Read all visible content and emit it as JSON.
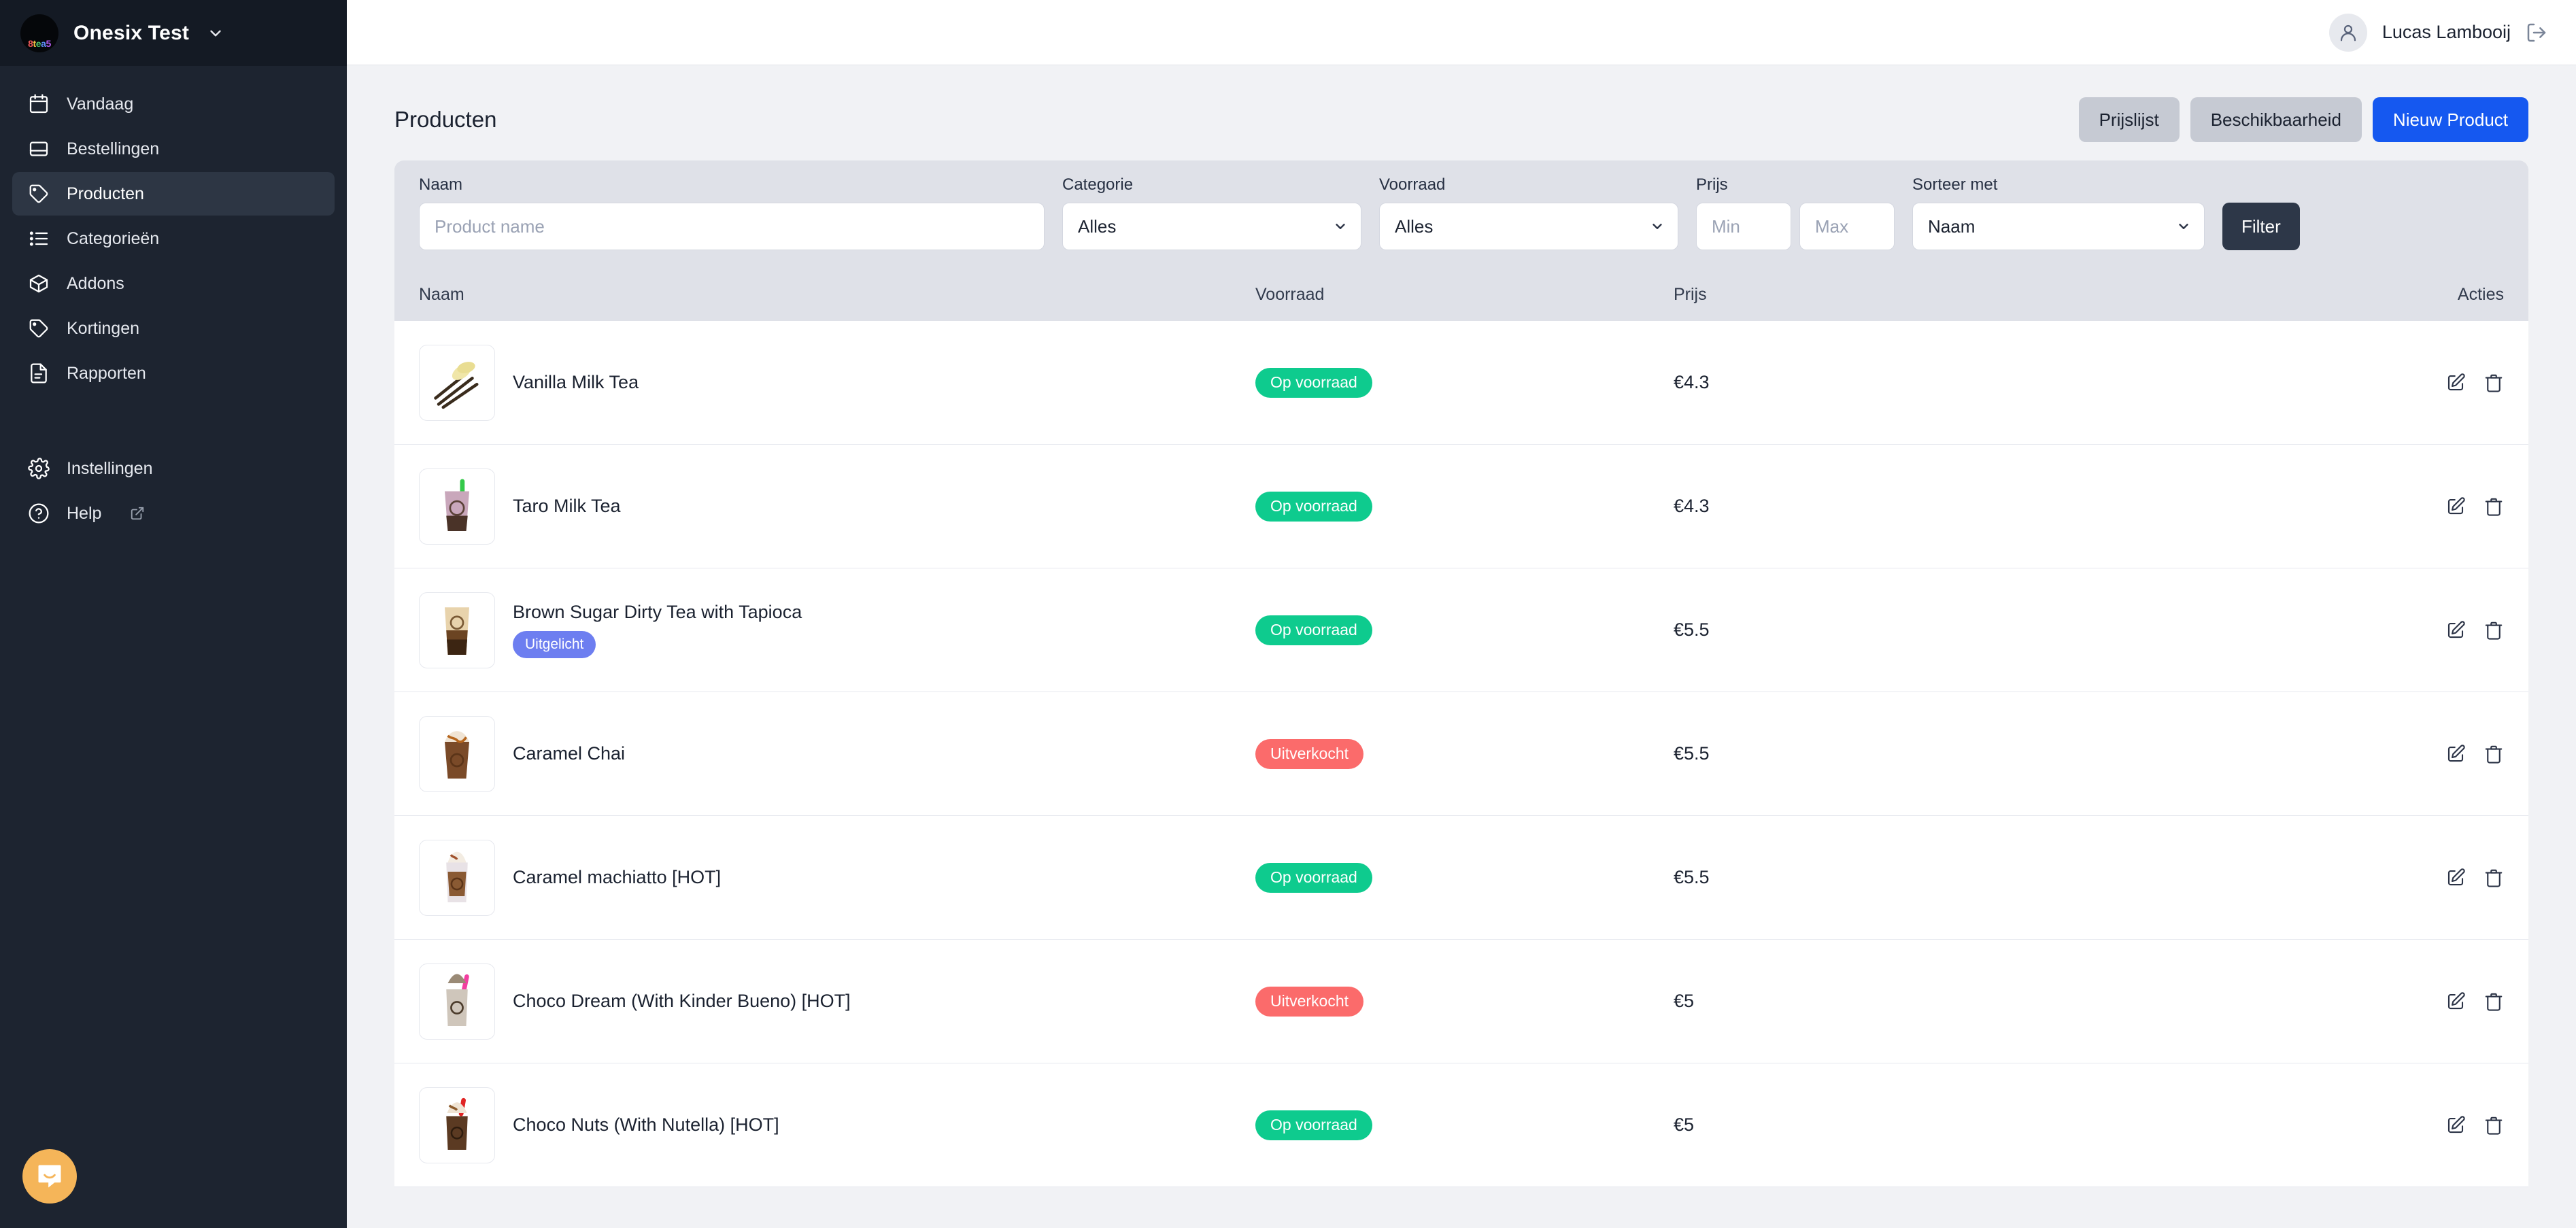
{
  "sidebar": {
    "brand": {
      "name": "Onesix Test",
      "logo_text": "8tea5",
      "caret_icon": "chevron-down-icon"
    },
    "items": [
      {
        "label": "Vandaag",
        "icon": "calendar-icon",
        "active": false
      },
      {
        "label": "Bestellingen",
        "icon": "inbox-icon",
        "active": false
      },
      {
        "label": "Producten",
        "icon": "tag-icon",
        "active": true
      },
      {
        "label": "Categorieën",
        "icon": "list-icon",
        "active": false
      },
      {
        "label": "Addons",
        "icon": "package-icon",
        "active": false
      },
      {
        "label": "Kortingen",
        "icon": "tag-icon",
        "active": false
      },
      {
        "label": "Rapporten",
        "icon": "document-icon",
        "active": false
      }
    ],
    "footer_items": [
      {
        "label": "Instellingen",
        "icon": "gear-icon",
        "external": false
      },
      {
        "label": "Help",
        "icon": "question-mark-icon",
        "external": true
      }
    ],
    "chat_icon": "intercom-chat-icon"
  },
  "topbar": {
    "user_name": "Lucas Lambooij",
    "avatar_icon": "user-avatar-icon",
    "logout_icon": "logout-icon"
  },
  "header": {
    "title": "Producten",
    "buttons": {
      "pricelist": "Prijslijst",
      "availability": "Beschikbaarheid",
      "new_product": "Nieuw Product"
    }
  },
  "filters": {
    "name": {
      "label": "Naam",
      "placeholder": "Product name",
      "value": ""
    },
    "category": {
      "label": "Categorie",
      "value": "Alles",
      "options": [
        "Alles"
      ]
    },
    "stock": {
      "label": "Voorraad",
      "value": "Alles",
      "options": [
        "Alles"
      ]
    },
    "price": {
      "label": "Prijs",
      "min_placeholder": "Min",
      "max_placeholder": "Max",
      "min_value": "",
      "max_value": ""
    },
    "sort": {
      "label": "Sorteer met",
      "value": "Naam",
      "options": [
        "Naam"
      ]
    },
    "submit": "Filter"
  },
  "table": {
    "headers": {
      "name": "Naam",
      "stock": "Voorraad",
      "price": "Prijs",
      "actions": "Acties"
    },
    "row_actions": {
      "edit_icon": "edit-icon",
      "delete_icon": "trash-icon"
    },
    "rows": [
      {
        "name": "Vanilla Milk Tea",
        "stock": "Op voorraad",
        "stock_state": "in",
        "price": "€4.3",
        "featured": null,
        "thumb": "vanilla-bean-image"
      },
      {
        "name": "Taro Milk Tea",
        "stock": "Op voorraad",
        "stock_state": "in",
        "price": "€4.3",
        "featured": null,
        "thumb": "taro-milk-tea-cup-image"
      },
      {
        "name": "Brown Sugar Dirty Tea with Tapioca",
        "stock": "Op voorraad",
        "stock_state": "in",
        "price": "€5.5",
        "featured": "Uitgelicht",
        "thumb": "brown-sugar-tea-cup-image"
      },
      {
        "name": "Caramel Chai",
        "stock": "Uitverkocht",
        "stock_state": "out",
        "price": "€5.5",
        "featured": null,
        "thumb": "caramel-chai-cup-image"
      },
      {
        "name": "Caramel machiatto [HOT]",
        "stock": "Op voorraad",
        "stock_state": "in",
        "price": "€5.5",
        "featured": null,
        "thumb": "caramel-machiatto-cup-image"
      },
      {
        "name": "Choco Dream (With Kinder Bueno) [HOT]",
        "stock": "Uitverkocht",
        "stock_state": "out",
        "price": "€5",
        "featured": null,
        "thumb": "choco-dream-cup-image"
      },
      {
        "name": "Choco Nuts (With Nutella) [HOT]",
        "stock": "Op voorraad",
        "stock_state": "in",
        "price": "€5",
        "featured": null,
        "thumb": "choco-nuts-cup-image"
      }
    ]
  },
  "colors": {
    "sidebar_bg": "#1d2430",
    "sidebar_active": "#2d3644",
    "primary": "#1558f0",
    "in_stock": "#0ecb8e",
    "out_of_stock": "#fb6b6b",
    "featured": "#6d7ef0",
    "filter_bar": "#dfe1e8",
    "filter_button": "#2d3748",
    "chat_bubble": "#f5b559"
  }
}
